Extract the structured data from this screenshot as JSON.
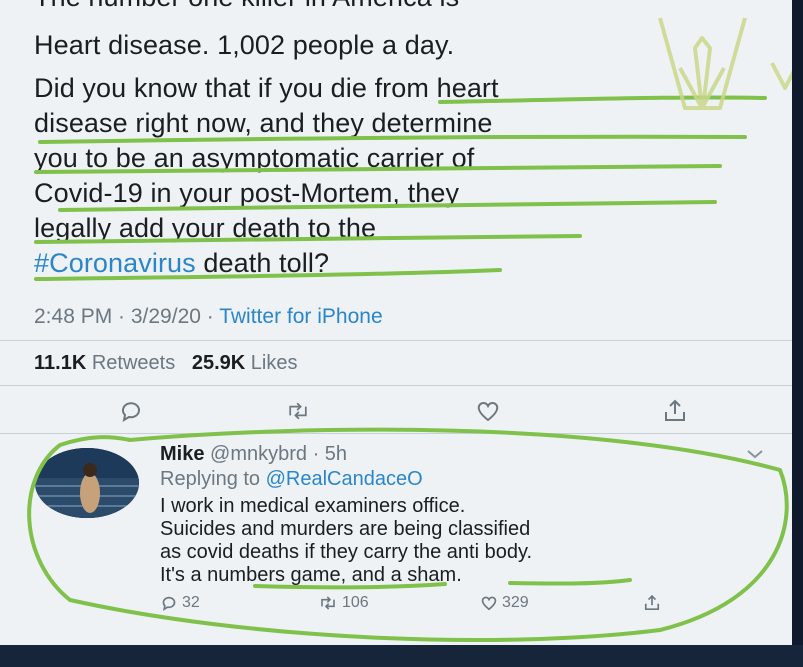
{
  "tweet": {
    "lines": [
      "The number one killer in America is",
      "Heart disease. 1,002 people a day.",
      "Did you know that if you die from heart",
      "disease right now, and they determine",
      "you to be an asymptomatic carrier of",
      "Covid-19 in your post-Mortem, they",
      "legally add your death to the"
    ],
    "hashtag": "#Coronavirus",
    "last_line_rest": " death toll?",
    "time": "2:48 PM · 3/29/20 · ",
    "source": "Twitter for iPhone",
    "retweets_count": "11.1K",
    "retweets_label": " Retweets",
    "likes_count": "25.9K",
    "likes_label": " Likes",
    "action_icons": [
      "reply-icon",
      "retweet-icon",
      "like-icon",
      "share-icon"
    ]
  },
  "reply": {
    "name": "Mike",
    "handle": " @mnkybrd · 5h",
    "replying_prefix": "Replying to ",
    "replying_to": "@RealCandaceO",
    "text_lines": [
      "I work in medical examiners office.",
      "Suicides and murders are being classified",
      "as covid deaths if they carry the anti body.",
      "It's a numbers game, and a sham."
    ],
    "reply_count": "32",
    "retweet_count": "106",
    "like_count": "329"
  },
  "colors": {
    "link": "#2b86c9",
    "annotation_green": "#7fc14a",
    "watermark": "#c9d88a"
  }
}
